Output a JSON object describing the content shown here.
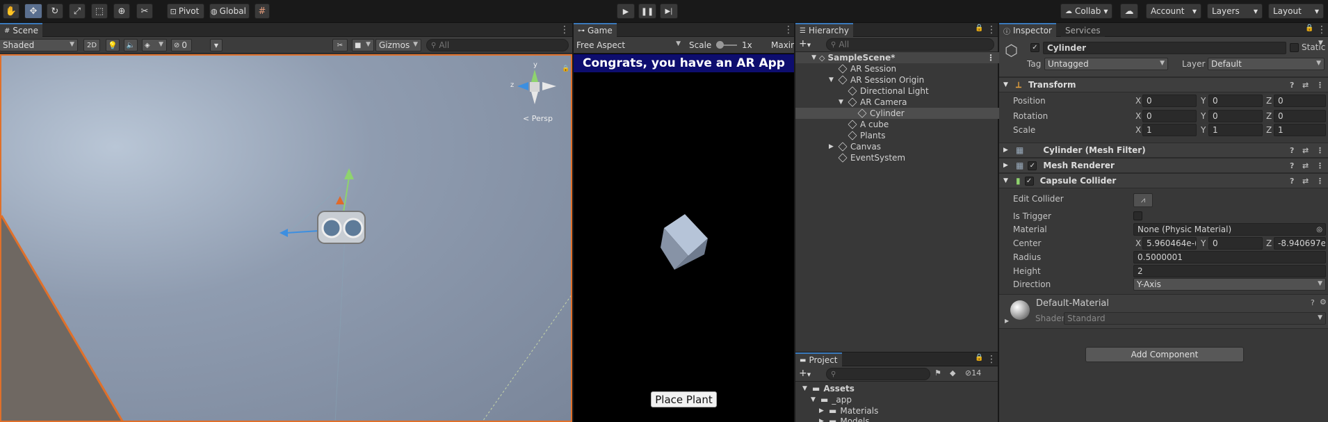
{
  "toolbar": {
    "pivot": "Pivot",
    "global": "Global",
    "collab": "Collab",
    "account": "Account",
    "layers": "Layers",
    "layout": "Layout"
  },
  "scene": {
    "tab": "Scene",
    "shading": "Shaded",
    "mode_2d": "2D",
    "hidden_count": "0",
    "gizmos": "Gizmos",
    "search_placeholder": "All",
    "gizmo_y": "y",
    "gizmo_z": "z",
    "persp": "Persp"
  },
  "game": {
    "tab": "Game",
    "aspect": "Free Aspect",
    "scale_label": "Scale",
    "scale_value": "1x",
    "maximize": "Maxin",
    "banner": "Congrats, you have an AR App",
    "place_button": "Place Plant"
  },
  "hierarchy": {
    "tab": "Hierarchy",
    "search_placeholder": "All",
    "items": [
      {
        "label": "SampleScene*",
        "depth": 0
      },
      {
        "label": "AR Session",
        "depth": 1
      },
      {
        "label": "AR Session Origin",
        "depth": 1
      },
      {
        "label": "Directional Light",
        "depth": 2
      },
      {
        "label": "AR Camera",
        "depth": 2
      },
      {
        "label": "Cylinder",
        "depth": 3
      },
      {
        "label": "A cube",
        "depth": 2
      },
      {
        "label": "Plants",
        "depth": 2
      },
      {
        "label": "Canvas",
        "depth": 1
      },
      {
        "label": "EventSystem",
        "depth": 1
      }
    ]
  },
  "project": {
    "tab": "Project",
    "hidden_count": "14",
    "items": [
      {
        "label": "Assets",
        "depth": 0
      },
      {
        "label": "_app",
        "depth": 1
      },
      {
        "label": "Materials",
        "depth": 2
      },
      {
        "label": "Models",
        "depth": 2
      }
    ]
  },
  "inspector": {
    "tab": "Inspector",
    "tab2": "Services",
    "object_name": "Cylinder",
    "static_label": "Static",
    "tag_label": "Tag",
    "tag_value": "Untagged",
    "layer_label": "Layer",
    "layer_value": "Default",
    "transform": {
      "title": "Transform",
      "position_label": "Position",
      "rotation_label": "Rotation",
      "scale_label": "Scale",
      "position": [
        "0",
        "0",
        "0"
      ],
      "rotation": [
        "0",
        "0",
        "0"
      ],
      "scale": [
        "1",
        "1",
        "1"
      ]
    },
    "mesh_filter": "Cylinder (Mesh Filter)",
    "mesh_renderer": "Mesh Renderer",
    "capsule": {
      "title": "Capsule Collider",
      "edit_label": "Edit Collider",
      "trigger_label": "Is Trigger",
      "material_label": "Material",
      "material_value": "None (Physic Material)",
      "center_label": "Center",
      "center": [
        "5.960464e-(",
        "0",
        "-8.940697e-"
      ],
      "radius_label": "Radius",
      "radius": "0.5000001",
      "height_label": "Height",
      "height": "2",
      "direction_label": "Direction",
      "direction": "Y-Axis"
    },
    "material": {
      "name": "Default-Material",
      "shader_label": "Shader",
      "shader": "Standard"
    },
    "add_component": "Add Component"
  },
  "axes": {
    "x": "X",
    "y": "Y",
    "z": "Z"
  }
}
